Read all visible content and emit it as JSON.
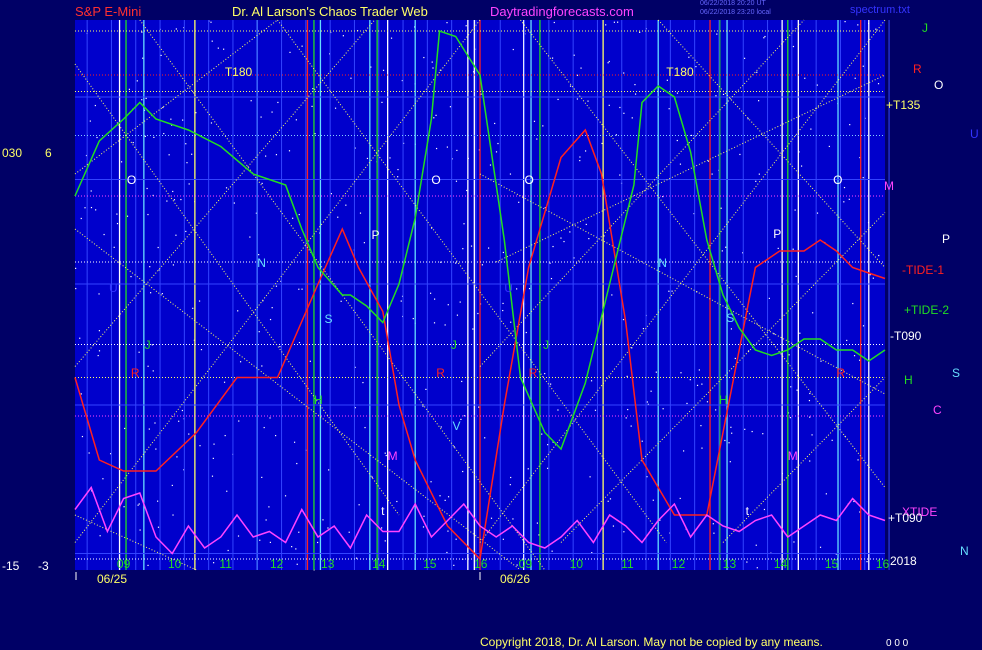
{
  "header": {
    "left_title": "S&P E-Mini",
    "center_title": "Dr. Al Larson's Chaos Trader Web",
    "site": "Daytradingforecasts.com",
    "stamp_1": "06/22/2018 20:20 UT",
    "stamp_2": "06/22/2018 23:20 local",
    "file": "spectrum.txt"
  },
  "footer": {
    "copyright": "Copyright 2018, Dr. Al Larson. May not be copied by any means.",
    "small": "0 0 0"
  },
  "colors": {
    "background": "#000066",
    "plot_bg": "#0000cc",
    "red": "#ff2020",
    "green": "#22dd22",
    "magenta": "#ff44ff",
    "yellow": "#ffff66",
    "cyan": "#66ddff",
    "white": "#ffffff",
    "blue": "#3333ff"
  },
  "chart_data": {
    "type": "line",
    "title": "",
    "y_left_labels": [
      "030",
      "6",
      "-15",
      "-3"
    ],
    "dates": [
      "06/25",
      "06/26"
    ],
    "x_hours_day1": [
      "09",
      "10",
      "11",
      "12",
      "13",
      "14",
      "15",
      "16"
    ],
    "x_hours_day2": [
      "09",
      "10",
      "11",
      "12",
      "13",
      "14",
      "15",
      "16"
    ],
    "right_labels": [
      {
        "text": "J",
        "color": "green"
      },
      {
        "text": "R",
        "color": "red"
      },
      {
        "text": "O",
        "color": "white"
      },
      {
        "text": "+T135",
        "color": "yellow"
      },
      {
        "text": "U",
        "color": "blue"
      },
      {
        "text": "M",
        "color": "magenta"
      },
      {
        "text": "P",
        "color": "white"
      },
      {
        "text": "-TIDE-1",
        "color": "red"
      },
      {
        "text": "+TIDE-2",
        "color": "green"
      },
      {
        "text": "-T090",
        "color": "white"
      },
      {
        "text": "H",
        "color": "green"
      },
      {
        "text": "S",
        "color": "cyan"
      },
      {
        "text": "C",
        "color": "magenta"
      },
      {
        "text": "XTIDE",
        "color": "magenta"
      },
      {
        "text": "+T090",
        "color": "white"
      },
      {
        "text": "2018",
        "color": "white"
      },
      {
        "text": "N",
        "color": "cyan"
      }
    ],
    "top_labels": [
      "T180",
      "T180"
    ],
    "planet_markers": [
      {
        "text": "O",
        "color": "white"
      },
      {
        "text": "O",
        "color": "white"
      },
      {
        "text": "O",
        "color": "white"
      },
      {
        "text": "O",
        "color": "white"
      },
      {
        "text": "P",
        "color": "white"
      },
      {
        "text": "P",
        "color": "white"
      },
      {
        "text": "N",
        "color": "cyan"
      },
      {
        "text": "N",
        "color": "cyan"
      },
      {
        "text": "S",
        "color": "cyan"
      },
      {
        "text": "S",
        "color": "cyan"
      },
      {
        "text": "J",
        "color": "green"
      },
      {
        "text": "J",
        "color": "green"
      },
      {
        "text": "J",
        "color": "green"
      },
      {
        "text": "R",
        "color": "red"
      },
      {
        "text": "R",
        "color": "red"
      },
      {
        "text": "R",
        "color": "red"
      },
      {
        "text": "R",
        "color": "red"
      },
      {
        "text": "H",
        "color": "green"
      },
      {
        "text": "H",
        "color": "green"
      },
      {
        "text": "M",
        "color": "magenta"
      },
      {
        "text": "M",
        "color": "magenta"
      },
      {
        "text": "V",
        "color": "cyan"
      },
      {
        "text": "t",
        "color": "white"
      },
      {
        "text": "t",
        "color": "white"
      },
      {
        "text": "U",
        "color": "blue"
      },
      {
        "text": "U",
        "color": "blue"
      }
    ],
    "series": [
      {
        "name": "-TIDE-1",
        "color": "red",
        "x": [
          0,
          3,
          6,
          10,
          15,
          20,
          25,
          30,
          33,
          35,
          38,
          40,
          42,
          46,
          50,
          53,
          56,
          60,
          63,
          65,
          68,
          70,
          74,
          78,
          80,
          84,
          87,
          90,
          92,
          94,
          96,
          98,
          100
        ],
        "y": [
          0.35,
          0.2,
          0.18,
          0.18,
          0.25,
          0.35,
          0.35,
          0.52,
          0.62,
          0.55,
          0.47,
          0.3,
          0.2,
          0.08,
          0.02,
          0.3,
          0.55,
          0.75,
          0.8,
          0.72,
          0.45,
          0.2,
          0.1,
          0.1,
          0.25,
          0.55,
          0.58,
          0.58,
          0.6,
          0.58,
          0.55,
          0.54,
          0.53
        ]
      },
      {
        "name": "+TIDE-2",
        "color": "green",
        "x": [
          0,
          3,
          6,
          8,
          10,
          14,
          18,
          22,
          26,
          28,
          30,
          33,
          34,
          36,
          38,
          40,
          42,
          44,
          45,
          47,
          50,
          53,
          55,
          58,
          60,
          63,
          66,
          69,
          70,
          72,
          74,
          76,
          78,
          80,
          82,
          84,
          86,
          88,
          90,
          92,
          94,
          96,
          98,
          100
        ],
        "y": [
          0.68,
          0.78,
          0.82,
          0.85,
          0.82,
          0.8,
          0.77,
          0.72,
          0.7,
          0.62,
          0.55,
          0.5,
          0.5,
          0.48,
          0.45,
          0.52,
          0.64,
          0.82,
          0.98,
          0.97,
          0.9,
          0.6,
          0.35,
          0.25,
          0.22,
          0.34,
          0.52,
          0.7,
          0.85,
          0.88,
          0.86,
          0.76,
          0.6,
          0.5,
          0.44,
          0.4,
          0.39,
          0.4,
          0.42,
          0.42,
          0.4,
          0.4,
          0.38,
          0.4
        ]
      },
      {
        "name": "XTIDE",
        "color": "magenta",
        "x": [
          0,
          2,
          4,
          6,
          8,
          10,
          12,
          14,
          16,
          18,
          20,
          22,
          24,
          26,
          28,
          30,
          32,
          34,
          36,
          38,
          40,
          42,
          44,
          46,
          48,
          50,
          52,
          54,
          56,
          58,
          60,
          62,
          64,
          66,
          68,
          70,
          72,
          74,
          76,
          78,
          80,
          82,
          84,
          86,
          88,
          90,
          92,
          94,
          96,
          98,
          100
        ],
        "y": [
          0.11,
          0.15,
          0.07,
          0.13,
          0.14,
          0.06,
          0.03,
          0.08,
          0.04,
          0.06,
          0.1,
          0.06,
          0.07,
          0.05,
          0.11,
          0.06,
          0.08,
          0.04,
          0.1,
          0.07,
          0.07,
          0.12,
          0.06,
          0.09,
          0.12,
          0.08,
          0.06,
          0.08,
          0.05,
          0.04,
          0.06,
          0.09,
          0.05,
          0.1,
          0.08,
          0.05,
          0.09,
          0.12,
          0.06,
          0.1,
          0.08,
          0.07,
          0.09,
          0.1,
          0.06,
          0.08,
          0.1,
          0.09,
          0.13,
          0.1,
          0.09
        ]
      }
    ]
  }
}
